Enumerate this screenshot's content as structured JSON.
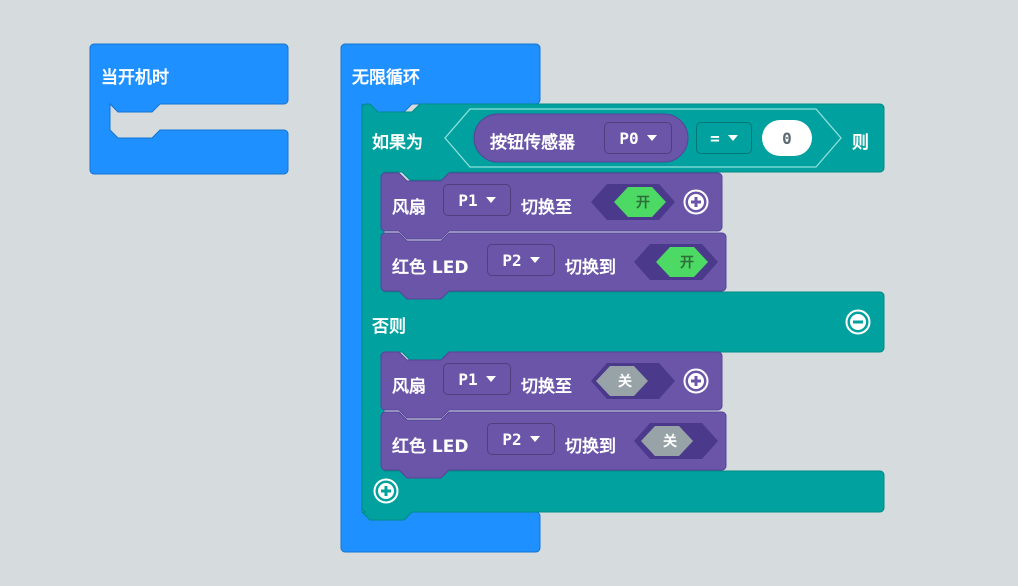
{
  "on_start": {
    "label": "当开机时"
  },
  "forever": {
    "label": "无限循环"
  },
  "if_block": {
    "if_label": "如果为",
    "then_label": "则",
    "else_label": "否则",
    "condition": {
      "sensor_label": "按钮传感器",
      "pin": "P0",
      "operator": "=",
      "value": "0"
    }
  },
  "then_statements": [
    {
      "device": "风扇",
      "pin": "P1",
      "action": "切换至",
      "state": "开",
      "state_color": "#4cd964"
    },
    {
      "device": "红色 LED",
      "pin": "P2",
      "action": "切换到",
      "state": "开",
      "state_color": "#4cd964"
    }
  ],
  "else_statements": [
    {
      "device": "风扇",
      "pin": "P1",
      "action": "切换至",
      "state": "关",
      "state_color": "#98a3a7"
    },
    {
      "device": "红色 LED",
      "pin": "P2",
      "action": "切换到",
      "state": "关",
      "state_color": "#98a3a7"
    }
  ],
  "colors": {
    "background": "#ecf0f1",
    "event_blue": "#1e90ff",
    "logic_teal": "#00a19e",
    "io_purple": "#6a55a8",
    "on_green": "#4cd964",
    "off_gray": "#98a3a7"
  }
}
